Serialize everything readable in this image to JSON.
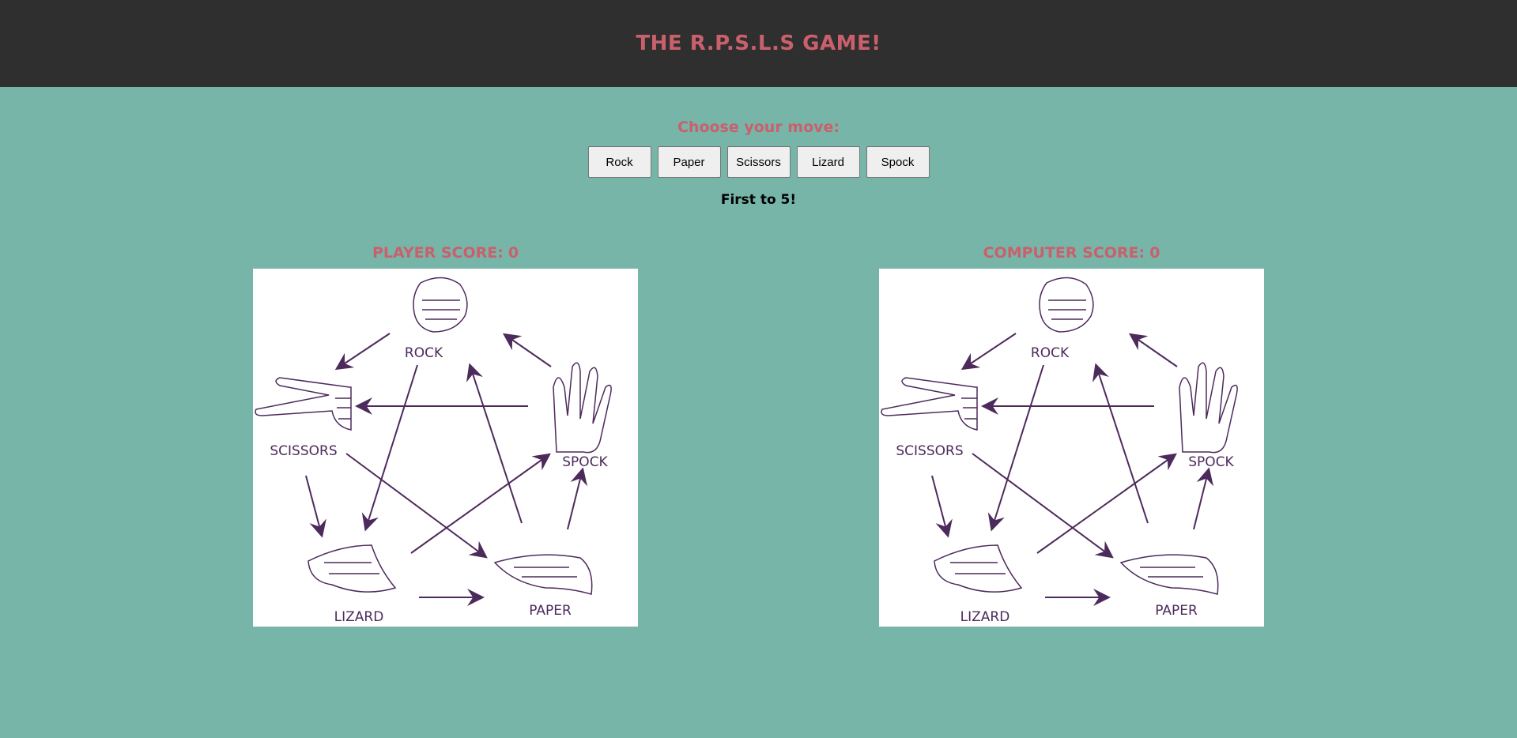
{
  "header": {
    "title": "THE R.P.S.L.S GAME!"
  },
  "controls": {
    "prompt": "Choose your move:",
    "moves": [
      "Rock",
      "Paper",
      "Scissors",
      "Lizard",
      "Spock"
    ],
    "rule": "First to 5!"
  },
  "player": {
    "label": "PLAYER SCORE:",
    "score": "0"
  },
  "computer": {
    "label": "COMPUTER SCORE:",
    "score": "0"
  },
  "diagram_labels": {
    "rock": "ROCK",
    "spock": "SPOCK",
    "paper": "PAPER",
    "lizard": "LIZARD",
    "scissors": "SCISSORS"
  },
  "colors": {
    "accent": "#c9606c",
    "background": "#77b5a9",
    "header": "#2f2f2f",
    "diagram_ink": "#4d2a5c"
  }
}
